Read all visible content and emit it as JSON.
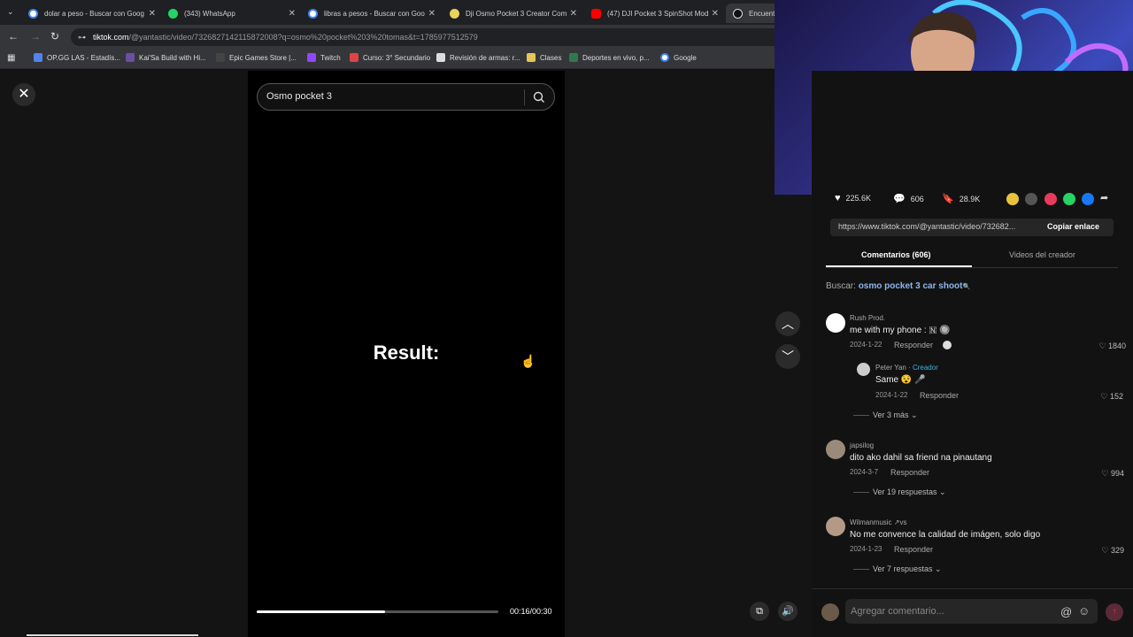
{
  "browser": {
    "tabs": [
      {
        "title": "dolar a peso - Buscar con Goog",
        "color": "#4285f4"
      },
      {
        "title": "(343) WhatsApp",
        "color": "#25d366"
      },
      {
        "title": "libras a pesos - Buscar con Goo",
        "color": "#4285f4"
      },
      {
        "title": "Dji Osmo Pocket 3 Creator Com",
        "color": "#e8d35c"
      },
      {
        "title": "(47) DJI Pocket 3 SpinShot Mod",
        "color": "#ff0000"
      },
      {
        "title": "Encuentra",
        "color": "#111"
      }
    ],
    "url_host": "tiktok.com",
    "url_path": "/@yantastic/video/7326827142115872008?q=osmo%20pocket%203%20tomas&t=1785977512579",
    "bookmarks": [
      {
        "label": "OP.GG LAS - Estadís..."
      },
      {
        "label": "Kai'Sa Build with Hi..."
      },
      {
        "label": "Epic Games Store |..."
      },
      {
        "label": "Twitch"
      },
      {
        "label": "Curso: 3° Secundario"
      },
      {
        "label": "Revisión de armas: r..."
      },
      {
        "label": "Clases"
      },
      {
        "label": "Deportes en vivo, p..."
      },
      {
        "label": "Google"
      }
    ]
  },
  "video": {
    "search_text": "Osmo pocket 3",
    "caption": "Result:",
    "time": "00:16/00:30",
    "progress": 0.53
  },
  "stats": {
    "likes": "225.6K",
    "comments": "606",
    "saves": "28.9K"
  },
  "link": {
    "url": "https://www.tiktok.com/@yantastic/video/732682...",
    "copy_label": "Copiar enlace"
  },
  "tabs": {
    "comments": "Comentarios (606)",
    "creator_videos": "Videos del creador"
  },
  "search": {
    "prefix": "Buscar:",
    "query": "osmo pocket 3 car shoot"
  },
  "comments": [
    {
      "user": "Rush Prod.",
      "text": "me with my phone : 🇳 🔘",
      "date": "2024-1-22",
      "reply": "Responder",
      "likes": "1840"
    },
    {
      "user": "Peter Yan",
      "badge": "Creador",
      "text": "Same 😵 🎤",
      "date": "2024-1-22",
      "reply": "Responder",
      "likes": "152"
    },
    {
      "more": "Ver 3 más"
    },
    {
      "user": "japsilog",
      "text": "dito ako dahil sa friend na pinautang",
      "date": "2024-3-7",
      "reply": "Responder",
      "likes": "994"
    },
    {
      "more": "Ver 19 respuestas"
    },
    {
      "user": "Wilmanmusic ↗vs",
      "text": "No me convence la calidad de imágen, solo digo",
      "date": "2024-1-23",
      "reply": "Responder",
      "likes": "329"
    },
    {
      "more": "Ver 7 respuestas"
    }
  ],
  "comment_bar": {
    "placeholder": "Agregar comentario..."
  }
}
